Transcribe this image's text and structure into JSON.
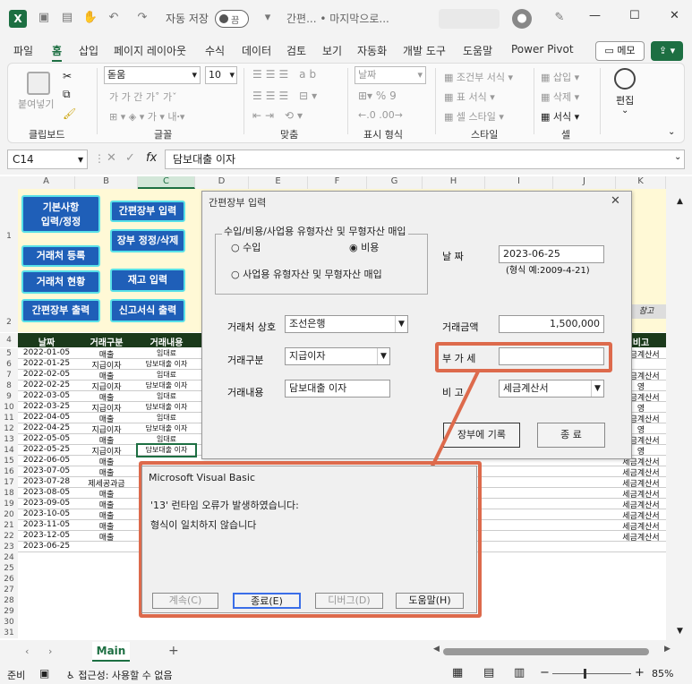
{
  "titlebar": {
    "autosave": "자동 저장",
    "toggle": "끔",
    "doc": "간편... • 마지막으로..."
  },
  "menu": [
    "파일",
    "홈",
    "삽입",
    "페이지 레이아웃",
    "수식",
    "데이터",
    "검토",
    "보기",
    "자동화",
    "개발 도구",
    "도움말",
    "Power Pivot"
  ],
  "memo": "메모",
  "ribbon": {
    "paste": "붙여넣기",
    "clipboard": "클립보드",
    "font_name": "돋움",
    "font_size": "10",
    "font": "글꼴",
    "align": "맞춤",
    "numfmt": "날짜",
    "numgroup": "표시 형식",
    "cond": "조건부 서식",
    "tblfmt": "표 서식",
    "cellstyle": "셀 스타일",
    "style": "스타일",
    "ins": "삽입",
    "del": "삭제",
    "fmt": "서식",
    "cells": "셀",
    "edit": "편집"
  },
  "formula": {
    "cell": "C14",
    "fx": "fx",
    "value": "담보대출 이자"
  },
  "columns": [
    "A",
    "B",
    "C",
    "D",
    "E",
    "F",
    "G",
    "H",
    "I",
    "J",
    "K"
  ],
  "banner_buttons": [
    "기본사항\n입력/정정",
    "간편장부 입력",
    "장부 정정/삭제",
    "거래처 등록",
    "재고 입력",
    "거래처 현황",
    "간편장부 출력",
    "신고서식 출력"
  ],
  "banner_tag": "참고",
  "table_headers": [
    "날짜",
    "거래구분",
    "거래내용",
    "비고"
  ],
  "rows": [
    {
      "r": "5",
      "date": "2022-01-05",
      "type": "매출",
      "desc": "임대료",
      "note": "세금계산서"
    },
    {
      "r": "6",
      "date": "2022-01-25",
      "type": "지급이자",
      "desc": "담보대출 이자",
      "note": ""
    },
    {
      "r": "7",
      "date": "2022-02-05",
      "type": "매출",
      "desc": "임대료",
      "note": "세금계산서"
    },
    {
      "r": "8",
      "date": "2022-02-25",
      "type": "지급이자",
      "desc": "담보대출 이자",
      "note": "영"
    },
    {
      "r": "9",
      "date": "2022-03-05",
      "type": "매출",
      "desc": "임대료",
      "note": "세금계산서"
    },
    {
      "r": "10",
      "date": "2022-03-25",
      "type": "지급이자",
      "desc": "담보대출 이자",
      "note": "영"
    },
    {
      "r": "11",
      "date": "2022-04-05",
      "type": "매출",
      "desc": "임대료",
      "note": "세금계산서"
    },
    {
      "r": "12",
      "date": "2022-04-25",
      "type": "지급이자",
      "desc": "담보대출 이자",
      "note": "영"
    },
    {
      "r": "13",
      "date": "2022-05-05",
      "type": "매출",
      "desc": "임대료",
      "note": "세금계산서"
    },
    {
      "r": "14",
      "date": "2022-05-25",
      "type": "지급이자",
      "desc": "담보대출 이자",
      "note": "영"
    },
    {
      "r": "15",
      "date": "2022-06-05",
      "type": "매출",
      "desc": "",
      "note": "세금계산서"
    },
    {
      "r": "16",
      "date": "2023-07-05",
      "type": "매출",
      "desc": "",
      "note": "세금계산서"
    },
    {
      "r": "17",
      "date": "2023-07-28",
      "type": "제세공과금",
      "desc": "",
      "note": "세금계산서"
    },
    {
      "r": "18",
      "date": "2023-08-05",
      "type": "매출",
      "desc": "",
      "note": "세금계산서"
    },
    {
      "r": "19",
      "date": "2023-09-05",
      "type": "매출",
      "desc": "",
      "note": "세금계산서"
    },
    {
      "r": "20",
      "date": "2023-10-05",
      "type": "매출",
      "desc": "",
      "note": "세금계산서"
    },
    {
      "r": "21",
      "date": "2023-11-05",
      "type": "매출",
      "desc": "",
      "note": "세금계산서"
    },
    {
      "r": "22",
      "date": "2023-12-05",
      "type": "매출",
      "desc": "",
      "note": "세금계산서"
    },
    {
      "r": "23",
      "date": "2023-06-25",
      "type": "",
      "desc": "",
      "note": ""
    }
  ],
  "empty_rows": [
    "24",
    "25",
    "26",
    "27",
    "28",
    "29",
    "30",
    "31"
  ],
  "dialog": {
    "title": "간편장부 입력",
    "frame_caption": "수입/비용/사업용 유형자산 및 무형자산 매입",
    "opt_income": "수입",
    "opt_expense": "비용",
    "opt_asset": "사업용 유형자산 및 무형자산 매입",
    "date_label": "날    짜",
    "date_value": "2023-06-25",
    "date_hint": "(형식 예:2009-4-21)",
    "client_label": "거래처 상호",
    "client_value": "조선은행",
    "amount_label": "거래금액",
    "amount_value": "1,500,000",
    "type_label": "거래구분",
    "type_value": "지급이자",
    "vat_label": "부 가 세",
    "vat_value": "",
    "desc_label": "거래내용",
    "desc_value": "담보대출 이자",
    "note_label": "비    고",
    "note_value": "세금계산서",
    "save_btn": "장부에 기록",
    "close_btn": "종    료"
  },
  "error": {
    "title": "Microsoft Visual Basic",
    "line1": "'13' 런타임 오류가 발생하였습니다:",
    "line2": "형식이 일치하지 않습니다",
    "continue": "계속(C)",
    "end": "종료(E)",
    "debug": "디버그(D)",
    "help": "도움말(H)"
  },
  "tabs": {
    "sheet": "Main"
  },
  "status": {
    "ready": "준비",
    "access": "접근성: 사용할 수 없음",
    "zoom": "85%"
  },
  "colors": {
    "excel_green": "#1d6f42",
    "annotation": "#dd6a4c",
    "banner_btn": "#1f5fb8"
  }
}
